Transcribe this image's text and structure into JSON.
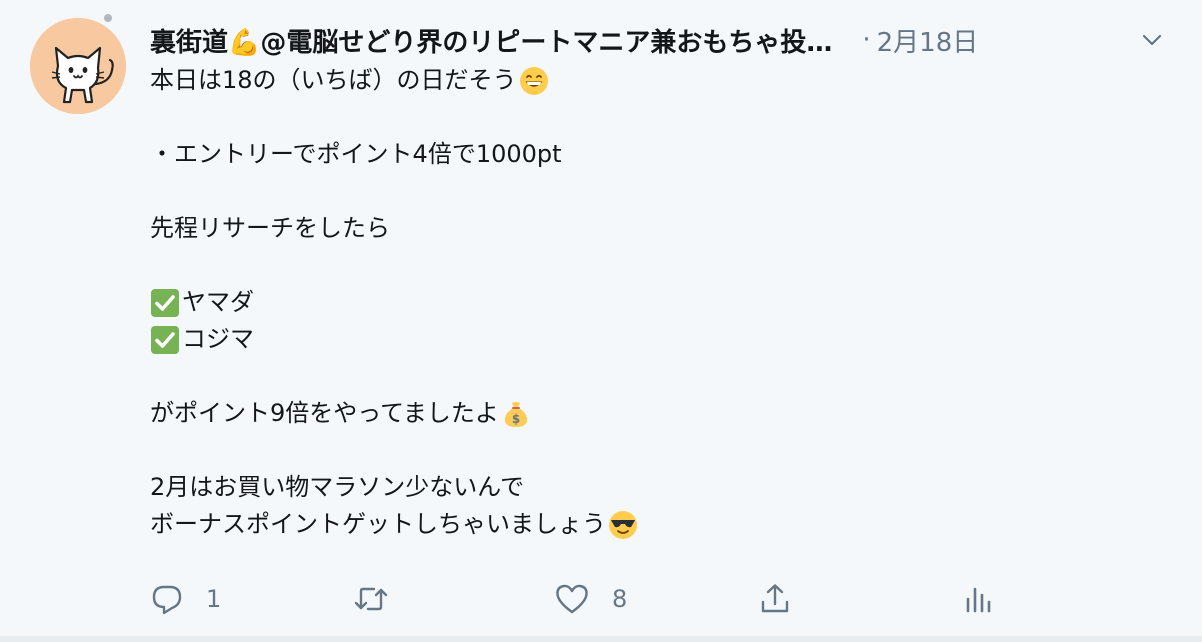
{
  "tweet": {
    "display_name": "裏街道💪@電脳せどり界のリピートマニア兼おもちゃ投…",
    "separator": "·",
    "timestamp": "2月18日",
    "lines": [
      "本日は18の（いちば）の日だそう",
      "",
      "・エントリーでポイント4倍で1000pt",
      "",
      "先程リサーチをしたら",
      "",
      "ヤマダ",
      "コジマ",
      "",
      "がポイント9倍をやってましたよ",
      "",
      "2月はお買い物マラソン少ないんで",
      "ボーナスポイントゲットしちゃいましょう"
    ],
    "line_decor": {
      "0": "grin-emoji",
      "6": "check-emoji",
      "7": "check-emoji",
      "9": "money-bag-emoji",
      "12": "sunglasses-emoji"
    }
  },
  "actions": {
    "reply_count": "1",
    "retweet_count": "",
    "like_count": "8"
  },
  "colors": {
    "background": "#f5f8fa",
    "text": "#14171a",
    "muted": "#657786",
    "avatar_bg": "#f8c9a0",
    "check_green": "#77b255"
  },
  "icons": {
    "reply": "reply-icon",
    "retweet": "retweet-icon",
    "like": "heart-icon",
    "share": "share-icon",
    "analytics": "analytics-icon",
    "caret": "chevron-down-icon"
  }
}
